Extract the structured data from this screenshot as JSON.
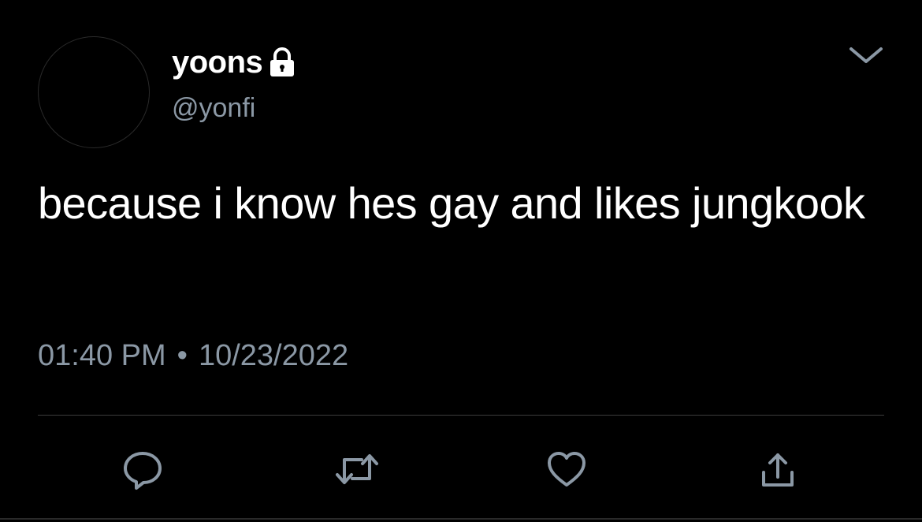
{
  "user": {
    "display_name": "yoons",
    "handle": "@yonfi",
    "protected_icon": "lock-icon"
  },
  "tweet": {
    "text": "because i know hes gay and likes jungkook",
    "time": "01:40 PM",
    "separator": "•",
    "date": "10/23/2022"
  },
  "actions": [
    {
      "name": "reply",
      "icon": "speech-bubble-icon"
    },
    {
      "name": "retweet",
      "icon": "retweet-arrows-icon"
    },
    {
      "name": "like",
      "icon": "heart-icon"
    },
    {
      "name": "share",
      "icon": "share-upload-icon"
    }
  ],
  "colors": {
    "background": "#000000",
    "primary_text": "#ffffff",
    "secondary_text": "#8b98a5",
    "divider": "#3d3d3d"
  }
}
